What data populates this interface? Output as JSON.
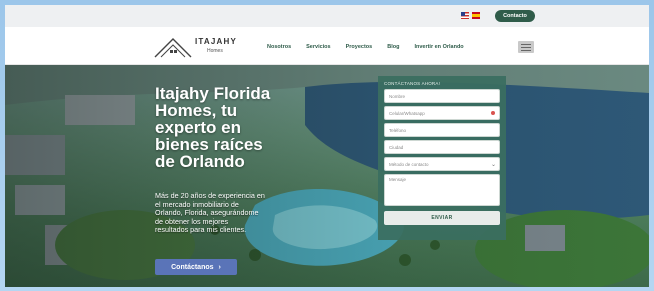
{
  "topbar": {
    "contact_label": "Contacto"
  },
  "logo": {
    "title": "ITAJAHY",
    "subtitle": "Homes"
  },
  "nav": {
    "items": [
      {
        "label": "Nosotros"
      },
      {
        "label": "Servicios"
      },
      {
        "label": "Proyectos"
      },
      {
        "label": "Blog"
      },
      {
        "label": "Invertir en Orlando"
      }
    ]
  },
  "hero": {
    "title_lines": [
      "Itajahy Florida",
      "Homes, tu",
      "experto en",
      "bienes raíces",
      "de Orlando"
    ],
    "description_lines": [
      "Más de 20 años de experiencia en",
      "el mercado inmobiliario de",
      "Orlando, Florida, asegurándome",
      "de obtener los mejores",
      "resultados para mis clientes."
    ],
    "cta_label": "Contáctanos",
    "cta_icon": "chevron-right-icon"
  },
  "form": {
    "title": "CONTÁCTANOS AHORA!",
    "placeholders": {
      "name": "Nombre",
      "phone": "Celular/Whatsapp",
      "phone2": "Teléfono",
      "city": "Ciudad",
      "contact_method": "Método de contacto",
      "message": "Mensaje"
    },
    "submit_label": "ENVIAR"
  },
  "colors": {
    "brand_green": "#2f5c4a",
    "form_bg": "#3a6e60",
    "cta_blue": "#5a74b8"
  }
}
